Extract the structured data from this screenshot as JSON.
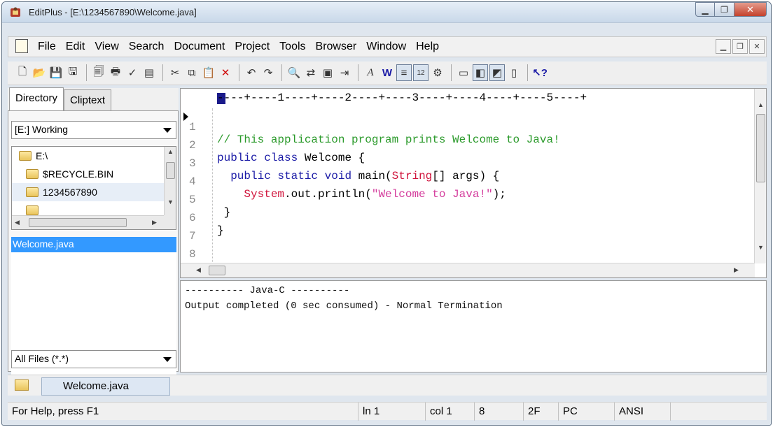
{
  "window": {
    "title": "EditPlus - [E:\\1234567890\\Welcome.java]"
  },
  "menubar": {
    "items": [
      "File",
      "Edit",
      "View",
      "Search",
      "Document",
      "Project",
      "Tools",
      "Browser",
      "Window",
      "Help"
    ]
  },
  "toolbar": {
    "icons": [
      "new-file-icon",
      "open-icon",
      "save-icon",
      "save-all-icon",
      "print-preview-icon",
      "print-icon",
      "spell-check-icon",
      "html-preview-icon",
      "cut-icon",
      "copy-icon",
      "paste-icon",
      "delete-icon",
      "undo-icon",
      "redo-icon",
      "find-icon",
      "replace-icon",
      "select-icon",
      "indent-icon",
      "font-icon",
      "word-wrap-icon",
      "ruler-icon",
      "line-number-icon",
      "preferences-icon",
      "layout-1-icon",
      "layout-2-icon",
      "layout-3-icon",
      "layout-4-icon",
      "help-icon"
    ]
  },
  "left_panel": {
    "tabs": [
      "Directory",
      "Cliptext"
    ],
    "drive_combo": "[E:] Working",
    "tree": [
      "E:\\",
      "$RECYCLE.BIN",
      "1234567890"
    ],
    "file_list": [
      "Welcome.java"
    ],
    "filter_combo": "All Files (*.*)"
  },
  "editor": {
    "ruler": "----+----1----+----2----+----3----+----4----+----5----+",
    "line_numbers": [
      "1",
      "2",
      "3",
      "4",
      "5",
      "6",
      "7",
      "8"
    ],
    "code": {
      "line1": "// This application program prints Welcome to Java!",
      "line2_kw1": "public",
      "line2_kw2": "class",
      "line2_rest": " Welcome {",
      "line3_indent": "  ",
      "line3_kw1": "public",
      "line3_kw2": "static",
      "line3_kw3": "void",
      "line3_name": " main(",
      "line3_type": "String",
      "line3_rest": "[] args) {",
      "line4_indent": "    ",
      "line4_type": "System",
      "line4_mid": ".out.println(",
      "line4_str": "\"Welcome to Java!\"",
      "line4_end": ");",
      "line5": " }",
      "line6": "}"
    }
  },
  "output": {
    "line1": "---------- Java-C ----------",
    "line2": "Output completed (0 sec consumed) - Normal Termination"
  },
  "document_tabs": [
    "Welcome.java"
  ],
  "statusbar": {
    "help": "For Help, press F1",
    "ln": "ln 1",
    "col": "col 1",
    "num": "8",
    "code": "2F",
    "mode": "PC",
    "encoding": "ANSI"
  }
}
